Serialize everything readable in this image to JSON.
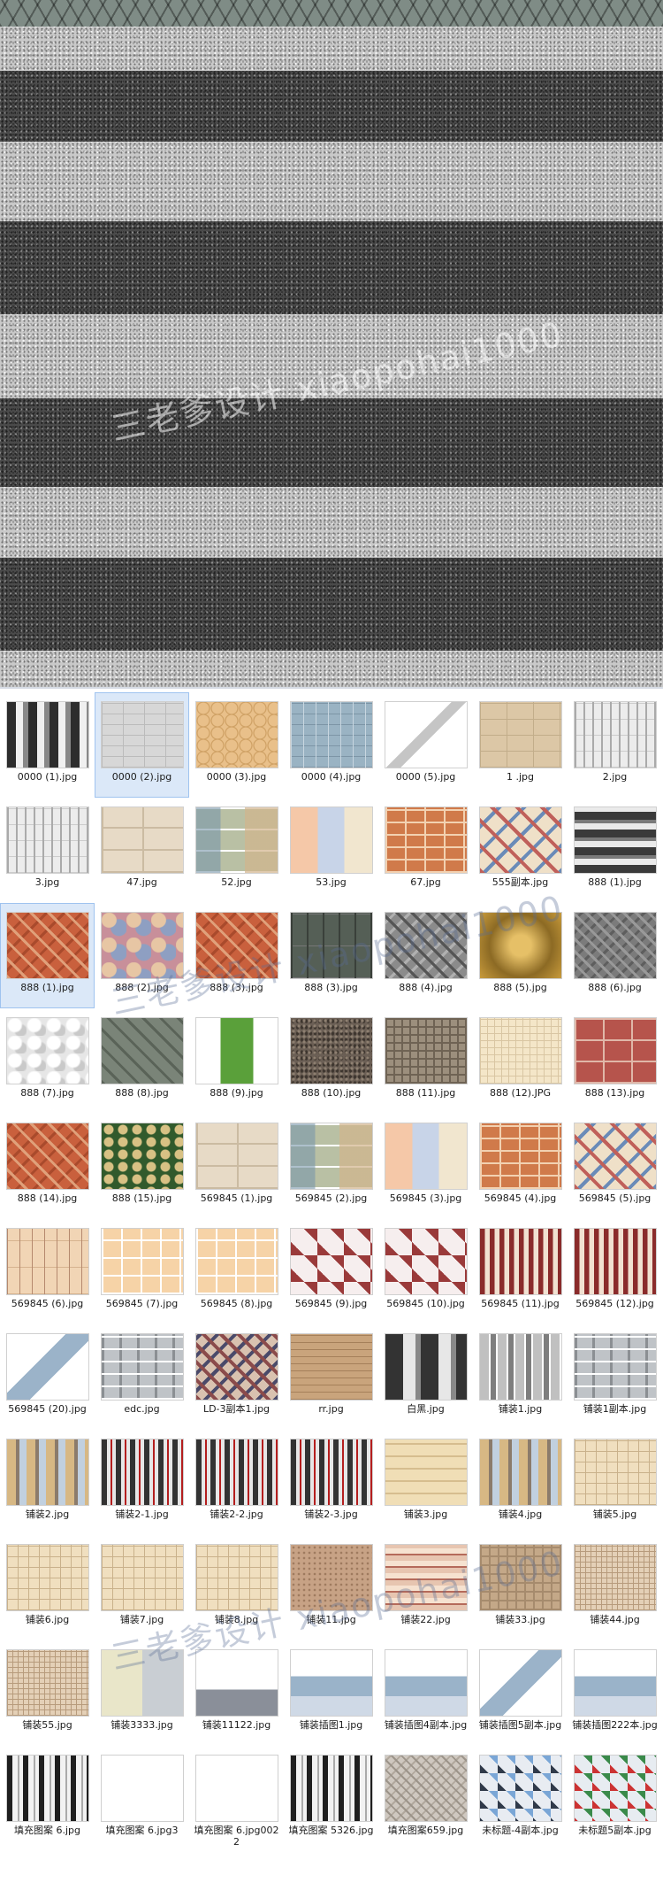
{
  "hero": {
    "watermark_text": "三老爹设计  xiaopohai1000",
    "bands": [
      "cobble",
      "light",
      "dark",
      "light",
      "dark",
      "light",
      "dark",
      "light",
      "dark",
      "light"
    ]
  },
  "watermarks": [
    {
      "text": "三老爹设计  xiaopohai1000"
    },
    {
      "text": "三老爹设计  xiaopohai1000"
    },
    {
      "text": "三老爹设计  xiaopohai1000"
    }
  ],
  "files": [
    {
      "name": "0000 (1).jpg",
      "texture": "stripes"
    },
    {
      "name": "0000 (2).jpg",
      "texture": "grey-brick",
      "selected": true
    },
    {
      "name": "0000 (3).jpg",
      "texture": "tan-hex"
    },
    {
      "name": "0000 (4).jpg",
      "texture": "blue-strip"
    },
    {
      "name": "0000 (5).jpg",
      "texture": "stair"
    },
    {
      "name": "1 .jpg",
      "texture": "beige"
    },
    {
      "name": "2.jpg",
      "texture": "light-grid"
    },
    {
      "name": "3.jpg",
      "texture": "light-grid"
    },
    {
      "name": "47.jpg",
      "texture": "cream-block"
    },
    {
      "name": "52.jpg",
      "texture": "multi"
    },
    {
      "name": "53.jpg",
      "texture": "pastel"
    },
    {
      "name": "67.jpg",
      "texture": "orange-brick"
    },
    {
      "name": "555副本.jpg",
      "texture": "diamond"
    },
    {
      "name": "888 (1).jpg",
      "texture": "dark-stripe"
    },
    {
      "name": "888 (1).jpg",
      "texture": "herring",
      "selected": true
    },
    {
      "name": "888 (2).jpg",
      "texture": "mosaic"
    },
    {
      "name": "888 (3).jpg",
      "texture": "herring"
    },
    {
      "name": "888 (3).jpg",
      "texture": "wood"
    },
    {
      "name": "888 (4).jpg",
      "texture": "chevron"
    },
    {
      "name": "888 (5).jpg",
      "texture": "gold"
    },
    {
      "name": "888 (6).jpg",
      "texture": "herring-grey"
    },
    {
      "name": "888 (7).jpg",
      "texture": "white-stone"
    },
    {
      "name": "888 (8).jpg",
      "texture": "green-paver"
    },
    {
      "name": "888 (9).jpg",
      "texture": "grass"
    },
    {
      "name": "888 (10).jpg",
      "texture": "rough"
    },
    {
      "name": "888 (11).jpg",
      "texture": "cobble"
    },
    {
      "name": "888 (12).JPG",
      "texture": "cream-grid"
    },
    {
      "name": "888 (13).jpg",
      "texture": "red-block"
    },
    {
      "name": "888 (14).jpg",
      "texture": "herring"
    },
    {
      "name": "888 (15).jpg",
      "texture": "hex-green"
    },
    {
      "name": "569845 (1).jpg",
      "texture": "cream-block"
    },
    {
      "name": "569845 (2).jpg",
      "texture": "multi"
    },
    {
      "name": "569845 (3).jpg",
      "texture": "pastel"
    },
    {
      "name": "569845 (4).jpg",
      "texture": "orange-brick"
    },
    {
      "name": "569845 (5).jpg",
      "texture": "diamond"
    },
    {
      "name": "569845 (6).jpg",
      "texture": "pink-brick"
    },
    {
      "name": "569845 (7).jpg",
      "texture": "peach-block"
    },
    {
      "name": "569845 (8).jpg",
      "texture": "peach-block"
    },
    {
      "name": "569845 (9).jpg",
      "texture": "red-check"
    },
    {
      "name": "569845 (10).jpg",
      "texture": "red-check"
    },
    {
      "name": "569845 (11).jpg",
      "texture": "maroon-check"
    },
    {
      "name": "569845 (12).jpg",
      "texture": "maroon-check"
    },
    {
      "name": "569845 (20).jpg",
      "texture": "stair2"
    },
    {
      "name": "edc.jpg",
      "texture": "grey-mix"
    },
    {
      "name": "LD-3副本1.jpg",
      "texture": "lattice"
    },
    {
      "name": "rr.jpg",
      "texture": "wood-strip"
    },
    {
      "name": "白黑.jpg",
      "texture": "bw-brick"
    },
    {
      "name": "铺装1.jpg",
      "texture": "sticks"
    },
    {
      "name": "铺装1副本.jpg",
      "texture": "grey-mix"
    },
    {
      "name": "铺装2.jpg",
      "texture": "vert-multi"
    },
    {
      "name": "铺装2-1.jpg",
      "texture": "fence"
    },
    {
      "name": "铺装2-2.jpg",
      "texture": "fence"
    },
    {
      "name": "铺装2-3.jpg",
      "texture": "fence"
    },
    {
      "name": "铺装3.jpg",
      "texture": "tan-stack"
    },
    {
      "name": "铺装4.jpg",
      "texture": "vert-multi"
    },
    {
      "name": "铺装5.jpg",
      "texture": "beige-cubes"
    },
    {
      "name": "铺装6.jpg",
      "texture": "beige-cubes"
    },
    {
      "name": "铺装7.jpg",
      "texture": "beige-cubes"
    },
    {
      "name": "铺装8.jpg",
      "texture": "beige-cubes"
    },
    {
      "name": "铺装11.jpg",
      "texture": "sand"
    },
    {
      "name": "铺装22.jpg",
      "texture": "pink-stripe"
    },
    {
      "name": "铺装33.jpg",
      "texture": "stone-grid"
    },
    {
      "name": "铺装44.jpg",
      "texture": "fine-grid"
    },
    {
      "name": "铺装55.jpg",
      "texture": "fine-grid"
    },
    {
      "name": "铺装3333.jpg",
      "texture": "mix-panel"
    },
    {
      "name": "铺装11122.jpg",
      "texture": "grey-band"
    },
    {
      "name": "铺装插图1.jpg",
      "texture": "blue-band"
    },
    {
      "name": "铺装插图4副本.jpg",
      "texture": "blue-band"
    },
    {
      "name": "铺装插图5副本.jpg",
      "texture": "stair2"
    },
    {
      "name": "铺装插图222本.jpg",
      "texture": "blue-band"
    },
    {
      "name": "填充图案 6.jpg",
      "texture": "bw-vert"
    },
    {
      "name": "填充图案 6.jpg3",
      "texture": "blank-file"
    },
    {
      "name": "填充图案 6.jpg0022",
      "texture": "blank-file"
    },
    {
      "name": "填充图案 5326.jpg",
      "texture": "bw-vert"
    },
    {
      "name": "填充图案659.jpg",
      "texture": "zigzag"
    },
    {
      "name": "未标题-4副本.jpg",
      "texture": "blue-diamond"
    },
    {
      "name": "未标题5副本.jpg",
      "texture": "red-diamond"
    }
  ]
}
